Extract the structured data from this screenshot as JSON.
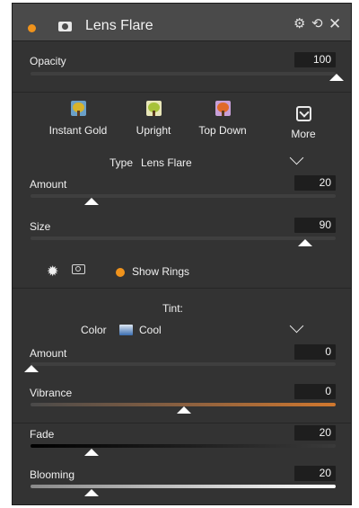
{
  "window": {
    "title": "Lens Flare"
  },
  "header_icons": {
    "enabled_dot": "enabled-dot-icon",
    "mask": "mask-icon",
    "settings": "gear-icon",
    "reset": "reset-icon",
    "close": "close-icon"
  },
  "opacity": {
    "label": "Opacity",
    "value": "100",
    "level": 1.0
  },
  "presets": [
    {
      "label": "Instant Gold",
      "icon": "tree-gold-icon",
      "color": "#d7b32a"
    },
    {
      "label": "Upright",
      "icon": "tree-upright-icon",
      "color": "#a7c23a"
    },
    {
      "label": "Top Down",
      "icon": "tree-topdown-icon",
      "color": "#e06a2a"
    },
    {
      "label": "More",
      "icon": "more-icon"
    }
  ],
  "type": {
    "label": "Type",
    "value": "Lens Flare"
  },
  "amount": {
    "label": "Amount",
    "value": "20",
    "level": 0.2
  },
  "size": {
    "label": "Size",
    "value": "90",
    "level": 0.9
  },
  "tools": {
    "flare_icon": "flare-star-icon",
    "camera_icon": "camera-icon",
    "show_rings": "Show Rings",
    "show_rings_color": "#f0931c"
  },
  "tint": {
    "heading": "Tint:",
    "color_label": "Color",
    "color_value": "Cool",
    "amount": {
      "label": "Amount",
      "value": "0",
      "level": 0.0
    },
    "vibrance": {
      "label": "Vibrance",
      "value": "0",
      "level": 0.5
    }
  },
  "fade": {
    "label": "Fade",
    "value": "20",
    "level": 0.2
  },
  "blooming": {
    "label": "Blooming",
    "value": "20",
    "level": 0.2
  },
  "colors": {
    "accent": "#f0931c",
    "vibrance_left": "#4a4a4a",
    "vibrance_right": "#d1782e"
  }
}
